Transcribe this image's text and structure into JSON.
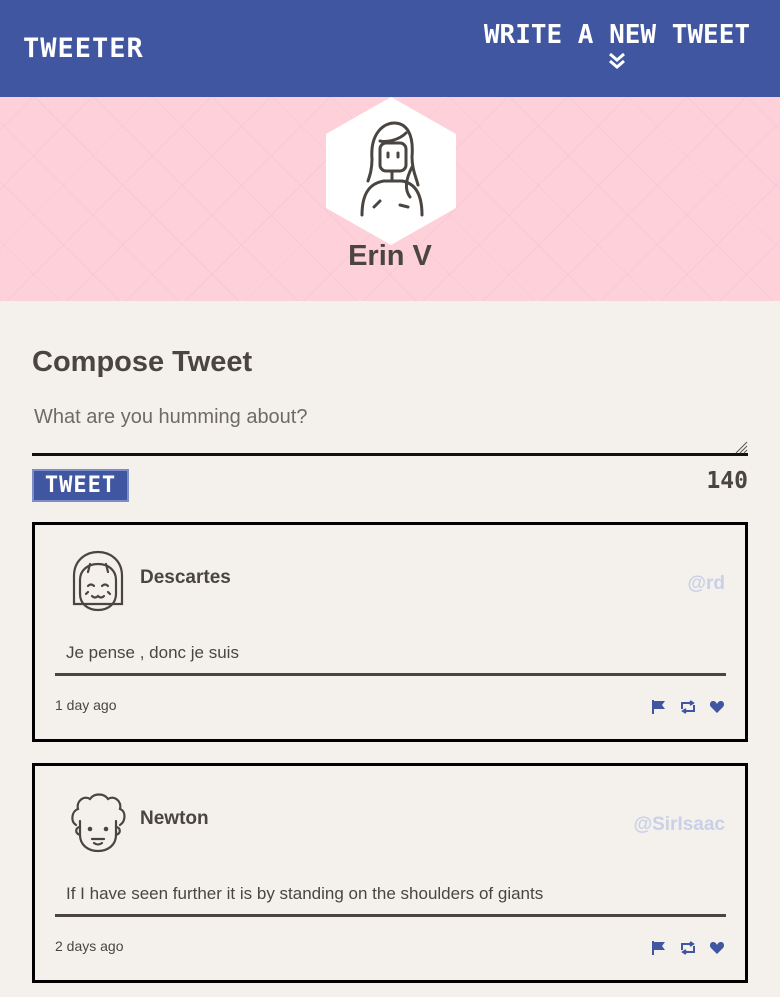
{
  "nav": {
    "brand": "Tweeter",
    "compose_link": "Write a new tweet",
    "compose_link_icon": "double-chevron-down-icon"
  },
  "profile": {
    "name": "Erin V",
    "avatar_icon": "woman-avatar-icon"
  },
  "compose": {
    "title": "Compose Tweet",
    "placeholder": "What are you humming about?",
    "value": "",
    "button_label": "Tweet",
    "counter": "140"
  },
  "tweets": [
    {
      "name": "Descartes",
      "handle": "@rd",
      "avatar_icon": "girl-avatar-icon",
      "text": "Je pense , donc je suis",
      "time": "1 day ago",
      "actions": [
        "flag-icon",
        "retweet-icon",
        "heart-icon"
      ]
    },
    {
      "name": "Newton",
      "handle": "@SirIsaac",
      "avatar_icon": "curly-hair-avatar-icon",
      "text": "If I have seen further it is by standing on the shoulders of giants",
      "time": "2 days ago",
      "actions": [
        "flag-icon",
        "retweet-icon",
        "heart-icon"
      ]
    }
  ],
  "colors": {
    "nav_bg": "#4056a1",
    "hero_bg": "#fdd0da",
    "page_bg": "#f4f1ec",
    "text": "#4a4540",
    "accent": "#4056a1",
    "handle": "#c9d0e8"
  }
}
